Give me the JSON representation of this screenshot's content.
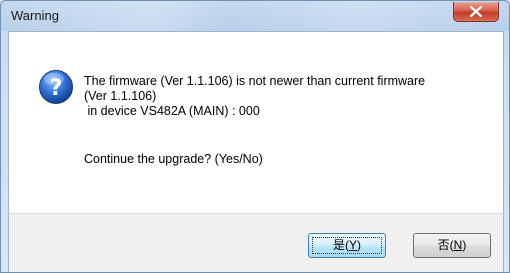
{
  "window": {
    "title": "Warning",
    "close_icon": "close-x-icon"
  },
  "dialog": {
    "icon": "question-icon",
    "message_lines": [
      "The firmware (Ver 1.1.106) is not newer than current firmware",
      "(Ver 1.1.106)",
      " in device VS482A (MAIN) : 000"
    ],
    "question": "Continue the upgrade? (Yes/No)"
  },
  "buttons": {
    "yes_label": "是(",
    "yes_accel": "Y",
    "yes_close": ")",
    "no_label": "否(",
    "no_accel": "N",
    "no_close": ")"
  },
  "colors": {
    "title_bg": "#b7cfea",
    "close_red": "#c23d28",
    "icon_blue": "#1f5fbf",
    "default_button": "#3c7fb1"
  }
}
